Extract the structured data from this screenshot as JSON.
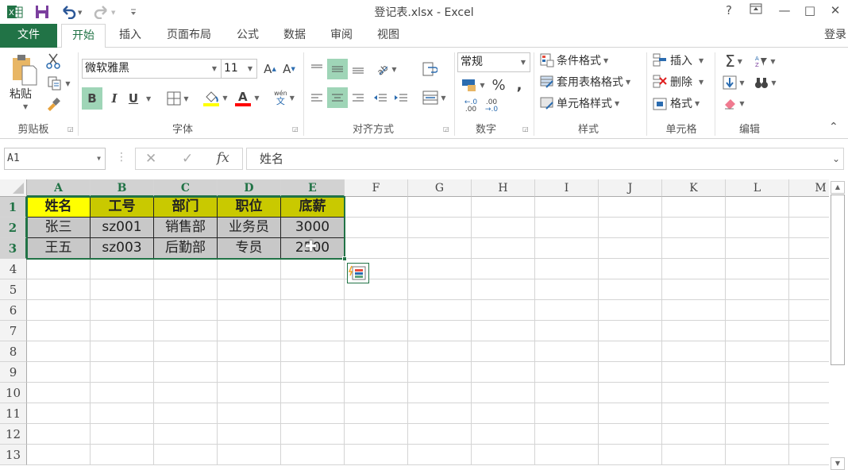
{
  "window": {
    "title": "登记表.xlsx - Excel",
    "help": "?",
    "ribbon_display": "ribbon-display-options",
    "minimize": "—",
    "maximize": "□",
    "close": "✕",
    "login": "登录"
  },
  "qat": {
    "app_icon": "excel-logo-icon",
    "save": "save-icon",
    "undo": "undo-icon",
    "redo": "redo-icon",
    "customize": "customize-qat-icon"
  },
  "tabs": [
    {
      "label": "文件"
    },
    {
      "label": "开始",
      "active": true
    },
    {
      "label": "插入"
    },
    {
      "label": "页面布局"
    },
    {
      "label": "公式"
    },
    {
      "label": "数据"
    },
    {
      "label": "审阅"
    },
    {
      "label": "视图"
    }
  ],
  "ribbon": {
    "clipboard": {
      "label": "剪贴板",
      "paste": "粘贴"
    },
    "font": {
      "label": "字体",
      "font_name": "微软雅黑",
      "font_size": "11",
      "bold": "B",
      "italic": "I",
      "underline": "U",
      "font_color": "A",
      "phonetic_top": "wén",
      "phonetic_bottom": "文",
      "fill_color": "#ffff00",
      "text_color": "#ff0000"
    },
    "alignment": {
      "label": "对齐方式"
    },
    "number": {
      "label": "数字",
      "format": "常规",
      "percent": "%",
      "comma": ",",
      "inc_decimal_top": "←.0",
      "inc_decimal_bottom": ".00",
      "dec_decimal_top": ".00",
      "dec_decimal_bottom": "→.0"
    },
    "styles": {
      "label": "样式",
      "conditional": "条件格式",
      "table_format": "套用表格格式",
      "cell_styles": "单元格样式"
    },
    "cells": {
      "label": "单元格",
      "insert": "插入",
      "delete": "删除",
      "format": "格式"
    },
    "editing": {
      "label": "编辑",
      "sum": "Σ",
      "sort": "A↓Z"
    }
  },
  "formula_bar": {
    "name_box": "A1",
    "cancel": "✕",
    "enter": "✓",
    "fx": "fx",
    "content": "姓名"
  },
  "sheet": {
    "columns": [
      "A",
      "B",
      "C",
      "D",
      "E",
      "F",
      "G",
      "H",
      "I",
      "J",
      "K",
      "L",
      "M"
    ],
    "rows": [
      "1",
      "2",
      "3",
      "4",
      "5",
      "6",
      "7",
      "8",
      "9",
      "10",
      "11",
      "12",
      "13"
    ],
    "cells": [
      [
        "姓名",
        "工号",
        "部门",
        "职位",
        "底薪"
      ],
      [
        "张三",
        "sz001",
        "销售部",
        "业务员",
        "3000"
      ],
      [
        "王五",
        "sz003",
        "后勤部",
        "专员",
        "2500"
      ]
    ],
    "selection": "A1:E3",
    "quick_analysis": "quick-analysis-icon"
  },
  "colors": {
    "accent": "#217346",
    "header_fill": "#c9c900",
    "first_header_fill": "#ffff00",
    "data_fill": "#c8c8c8"
  }
}
